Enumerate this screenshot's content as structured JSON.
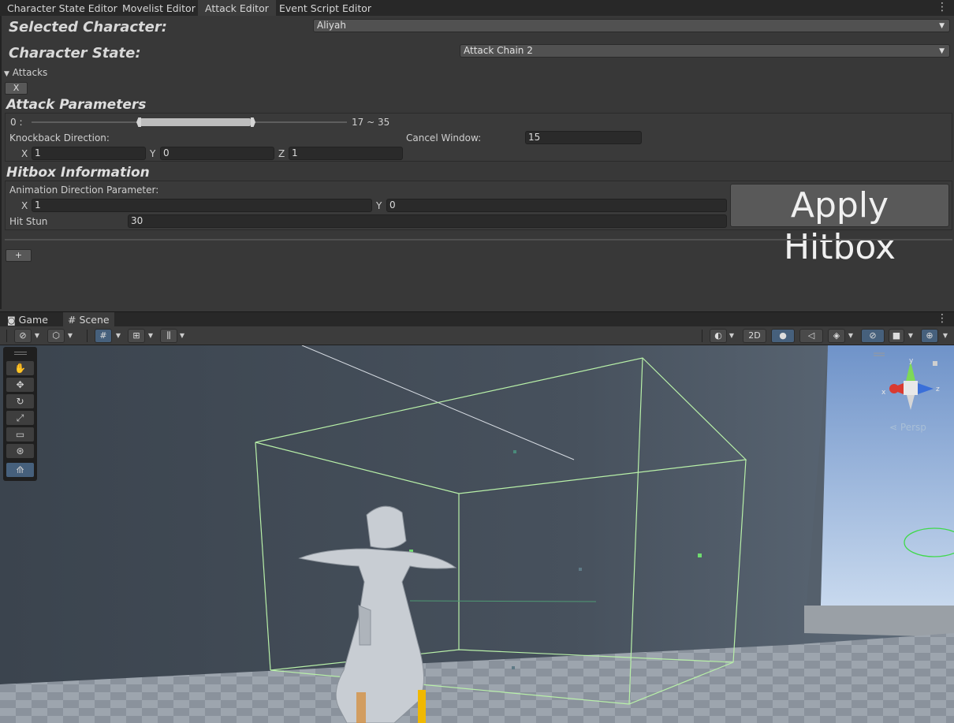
{
  "editor_tabs": [
    "Character State Editor",
    "Movelist Editor",
    "Attack Editor",
    "Event Script Editor"
  ],
  "selected_character": {
    "label": "Selected Character:",
    "value": "Aliyah"
  },
  "character_state": {
    "label": "Character State:",
    "value": "Attack Chain 2"
  },
  "attacks": {
    "foldout_label": "Attacks",
    "remove_label": "X",
    "add_label": "+"
  },
  "attack_parameters": {
    "title": "Attack Parameters",
    "frame_range_label": "0 :",
    "frame_range_value": "17 ~ 35",
    "range_min": 17,
    "range_max": 35,
    "range_limit": 50,
    "knockback_label": "Knockback Direction:",
    "knockback": {
      "x_label": "X",
      "x": "1",
      "y_label": "Y",
      "y": "0",
      "z_label": "Z",
      "z": "1"
    },
    "cancel_window_label": "Cancel Window:",
    "cancel_window": "15"
  },
  "hitbox_information": {
    "title": "Hitbox Information",
    "anim_dir_label": "Animation Direction Parameter:",
    "anim_dir": {
      "x_label": "X",
      "x": "1",
      "y_label": "Y",
      "y": "0"
    },
    "hit_stun_label": "Hit Stun",
    "hit_stun": "30",
    "apply_label": "Apply Hitbox"
  },
  "scene_tabs": [
    {
      "icon": "gamepad-icon",
      "label": "Game"
    },
    {
      "icon": "hash-icon",
      "label": "Scene"
    }
  ],
  "scene_toolbar": {
    "mode_2d": "2D"
  },
  "gizmo": {
    "projection_label": "Persp",
    "axis_x": "x",
    "axis_y": "y",
    "axis_z": "z"
  },
  "colors": {
    "accent": "#46607c",
    "hitbox_wire": "#b8f0a8",
    "axis_y": "#7ed957",
    "axis_x": "#d93a30",
    "axis_z": "#3a6fd9"
  }
}
